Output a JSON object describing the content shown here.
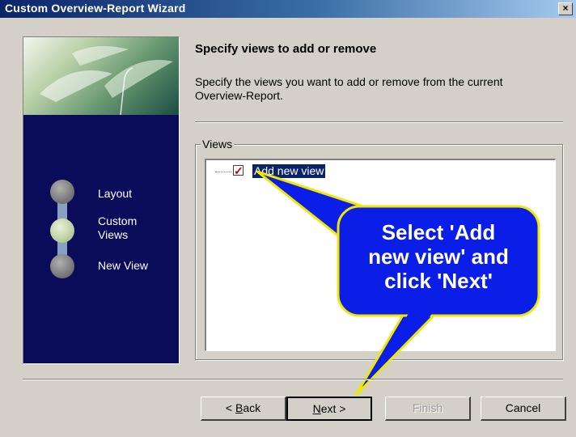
{
  "window": {
    "title": "Custom Overview-Report Wizard",
    "close_glyph": "×"
  },
  "sidebar": {
    "steps": [
      {
        "label_lines": [
          "Layout"
        ],
        "state": "done"
      },
      {
        "label_lines": [
          "Custom",
          "Views"
        ],
        "state": "current"
      },
      {
        "label_lines": [
          "New View"
        ],
        "state": "pending"
      }
    ]
  },
  "header": {
    "title": "Specify views to add or remove",
    "description": "Specify the views you want to add or remove from the current Overview-Report."
  },
  "views_group": {
    "label": "Views",
    "items": [
      {
        "label": "Add new view",
        "checked": true,
        "selected": true
      }
    ]
  },
  "callout": {
    "lines": [
      "Select 'Add",
      "new view' and",
      "click 'Next'"
    ],
    "fill_color": "#0a1ee8",
    "border_color": "#f0e800"
  },
  "buttons": {
    "back_prefix": "< ",
    "back_mnemonic": "B",
    "back_suffix": "ack",
    "next_mnemonic": "N",
    "next_suffix": "ext >",
    "finish": "Finish",
    "cancel": "Cancel"
  },
  "colors": {
    "titlebar": "#0a246a",
    "sidebar_bg": "#0a0c5a",
    "dialog_bg": "#d4d0c8"
  }
}
